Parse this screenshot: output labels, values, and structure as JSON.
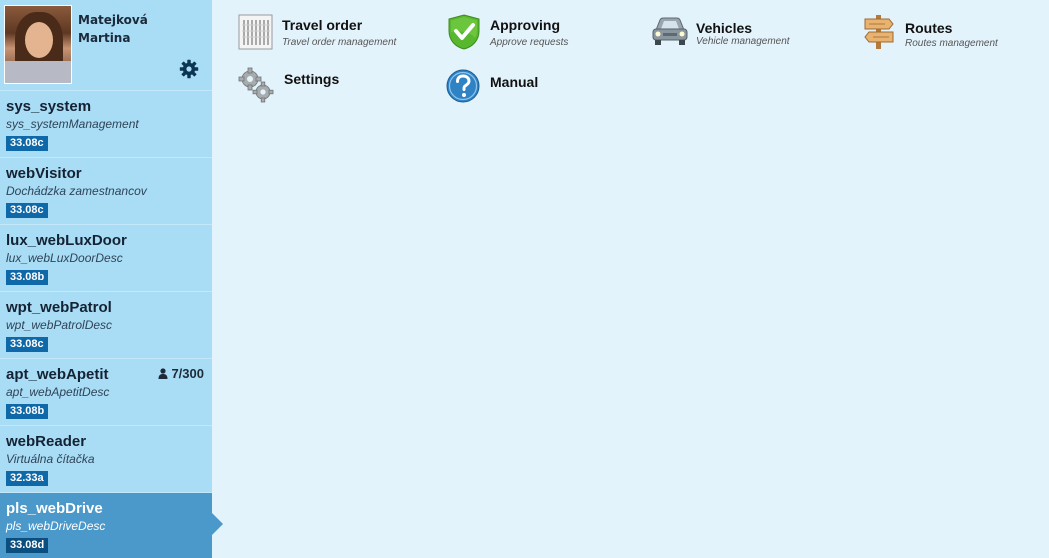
{
  "user": {
    "last_name": "Matejková",
    "first_name": "Martina",
    "settings_icon": "gear-icon"
  },
  "apps": [
    {
      "name": "sys_system",
      "desc": "sys_systemManagement",
      "version": "33.08c"
    },
    {
      "name": "webVisitor",
      "desc": "Dochádzka zamestnancov",
      "version": "33.08c"
    },
    {
      "name": "lux_webLuxDoor",
      "desc": "lux_webLuxDoorDesc",
      "version": "33.08b"
    },
    {
      "name": "wpt_webPatrol",
      "desc": "wpt_webPatrolDesc",
      "version": "33.08c"
    },
    {
      "name": "apt_webApetit",
      "desc": "apt_webApetitDesc",
      "version": "33.08b",
      "count": "7/300"
    },
    {
      "name": "webReader",
      "desc": "Virtuálna čítačka",
      "version": "32.33a"
    },
    {
      "name": "pls_webDrive",
      "desc": "pls_webDriveDesc",
      "version": "33.08d",
      "active": true
    }
  ],
  "tiles": [
    {
      "title": "Travel order",
      "subtitle": "Travel order management",
      "icon": "document-list-icon"
    },
    {
      "title": "Approving",
      "subtitle": "Approve requests",
      "icon": "shield-check-icon"
    },
    {
      "title": "Vehicles",
      "subtitle": "Vehicle management",
      "icon": "car-icon"
    },
    {
      "title": "Routes",
      "subtitle": "Routes management",
      "icon": "signpost-icon"
    },
    {
      "title": "Settings",
      "subtitle": "",
      "icon": "gears-icon"
    },
    {
      "title": "Manual",
      "subtitle": "",
      "icon": "help-icon"
    }
  ],
  "colors": {
    "sidebar": "#a9dcf5",
    "active": "#4b98cb",
    "badge": "#0f68a8",
    "content_bg": "#e3f3fc"
  }
}
